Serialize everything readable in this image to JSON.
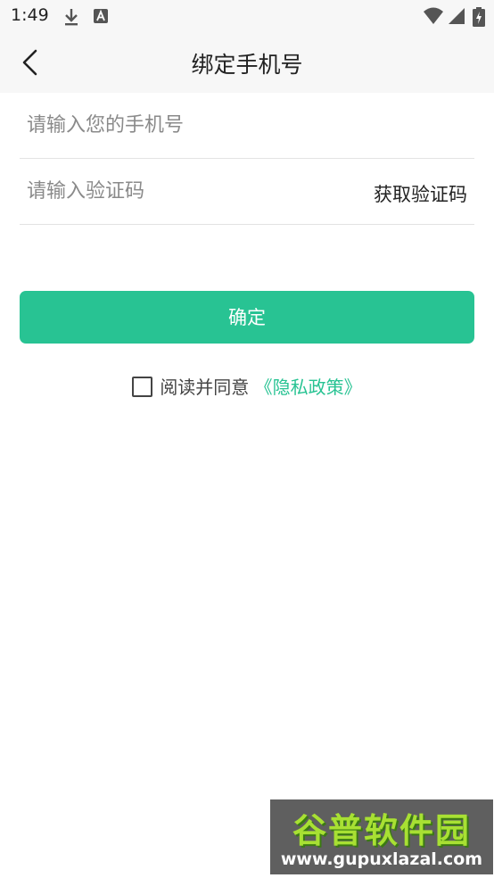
{
  "status_bar": {
    "time": "1:49",
    "icons": [
      "download-icon",
      "a-badge-icon",
      "wifi-icon",
      "signal-icon",
      "battery-charging-icon"
    ]
  },
  "header": {
    "title": "绑定手机号",
    "back_icon": "chevron-left-icon"
  },
  "form": {
    "phone_placeholder": "请输入您的手机号",
    "phone_value": "",
    "code_placeholder": "请输入验证码",
    "code_value": "",
    "get_code_label": "获取验证码",
    "confirm_label": "确定"
  },
  "agreement": {
    "checked": false,
    "text": "阅读并同意",
    "policy_link": "《隐私政策》"
  },
  "watermark": {
    "top": "谷普软件园",
    "bottom": "www.gupuxlazal.com"
  },
  "colors": {
    "accent": "#28c393",
    "header_bg": "#f7f7f7",
    "divider": "#e3e3e3"
  }
}
